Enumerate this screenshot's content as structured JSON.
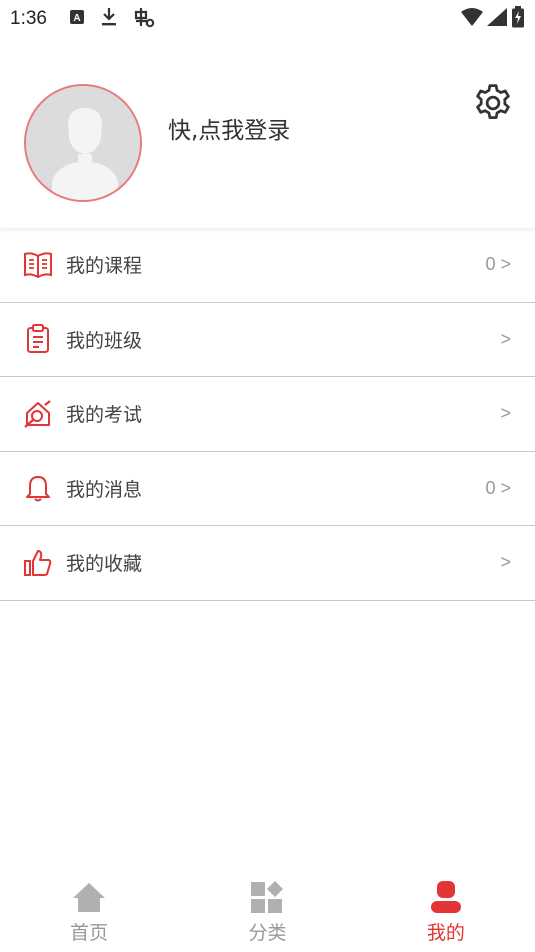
{
  "status_bar": {
    "time": "1:36",
    "icons": [
      "keyboard-a-icon",
      "download-icon",
      "bug-icon",
      "wifi-icon",
      "signal-icon",
      "battery-charging-icon"
    ]
  },
  "profile": {
    "login_text": "快,点我登录",
    "avatar_icon": "default-avatar-icon",
    "settings_icon": "gear-icon"
  },
  "menu": {
    "items": [
      {
        "label": "我的课程",
        "right": "0 >",
        "icon": "open-book-icon"
      },
      {
        "label": "我的班级",
        "right": ">",
        "icon": "clipboard-icon"
      },
      {
        "label": "我的考试",
        "right": ">",
        "icon": "exam-pen-icon"
      },
      {
        "label": "我的消息",
        "right": "0 >",
        "icon": "bell-icon"
      },
      {
        "label": "我的收藏",
        "right": ">",
        "icon": "thumbs-up-icon"
      }
    ]
  },
  "tabbar": {
    "tabs": [
      {
        "label": "首页",
        "icon": "home-icon",
        "active": false
      },
      {
        "label": "分类",
        "icon": "category-grid-icon",
        "active": false
      },
      {
        "label": "我的",
        "icon": "user-icon",
        "active": true
      }
    ]
  },
  "colors": {
    "accent": "#e23535",
    "avatar_border": "#e87a7a",
    "inactive": "#999999",
    "divider": "#c8c8c8"
  }
}
